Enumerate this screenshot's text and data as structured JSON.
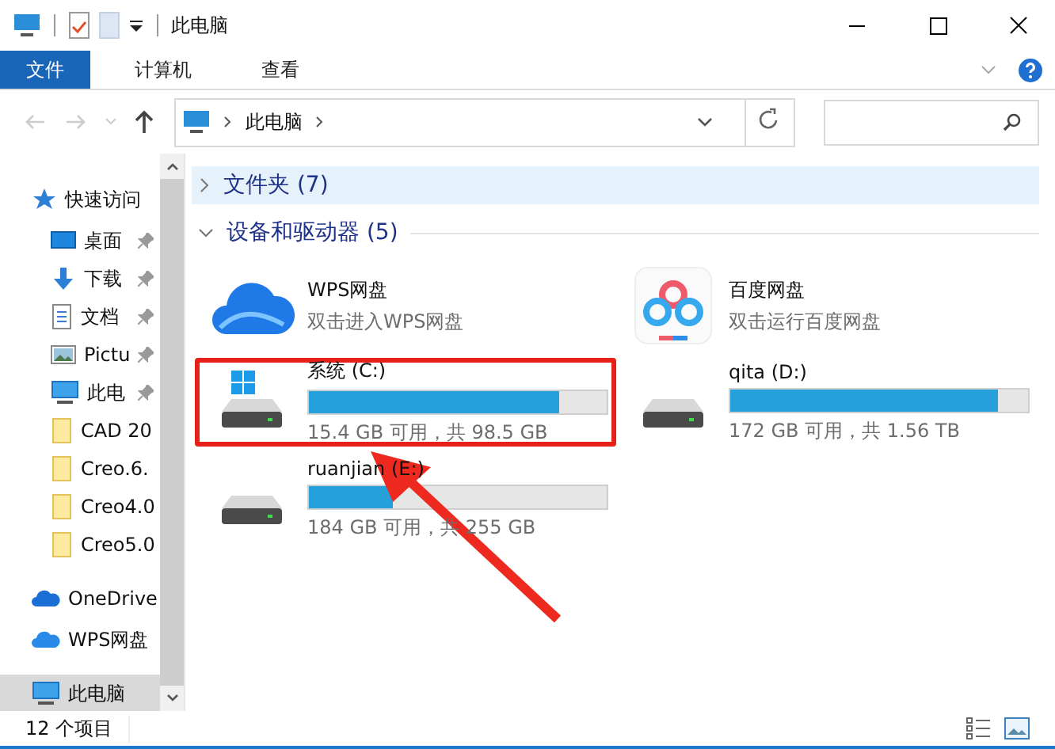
{
  "window": {
    "title": "此电脑"
  },
  "ribbon_tabs": [
    {
      "label": "文件",
      "selected": true
    },
    {
      "label": "计算机",
      "selected": false
    },
    {
      "label": "查看",
      "selected": false
    }
  ],
  "address": {
    "crumbs": [
      "此电脑"
    ]
  },
  "sidebar": {
    "items": [
      {
        "label": "快速访问",
        "kind": "star",
        "pinned": false,
        "selected": false,
        "group": true
      },
      {
        "label": "桌面",
        "kind": "desktop",
        "pinned": true,
        "selected": false,
        "group": false
      },
      {
        "label": "下载",
        "kind": "download",
        "pinned": true,
        "selected": false,
        "group": false
      },
      {
        "label": "文档",
        "kind": "document",
        "pinned": true,
        "selected": false,
        "group": false
      },
      {
        "label": "Pictu",
        "kind": "picture",
        "pinned": true,
        "selected": false,
        "group": false
      },
      {
        "label": "此电",
        "kind": "computer",
        "pinned": true,
        "selected": false,
        "group": false
      },
      {
        "label": "CAD 20",
        "kind": "folder",
        "pinned": false,
        "selected": false,
        "group": false
      },
      {
        "label": "Creo.6.",
        "kind": "folder",
        "pinned": false,
        "selected": false,
        "group": false
      },
      {
        "label": "Creo4.0",
        "kind": "folder",
        "pinned": false,
        "selected": false,
        "group": false
      },
      {
        "label": "Creo5.0",
        "kind": "folder",
        "pinned": false,
        "selected": false,
        "group": false
      },
      {
        "label": "OneDrive",
        "kind": "onedrive",
        "pinned": false,
        "selected": false,
        "group": true
      },
      {
        "label": "WPS网盘",
        "kind": "wps",
        "pinned": false,
        "selected": false,
        "group": true
      },
      {
        "label": "此电脑",
        "kind": "computer",
        "pinned": false,
        "selected": true,
        "group": true
      }
    ]
  },
  "sections": [
    {
      "title": "文件夹 (7)",
      "expanded": false
    },
    {
      "title": "设备和驱动器 (5)",
      "expanded": true
    }
  ],
  "devices": [
    {
      "kind": "wps",
      "name": "WPS网盘",
      "detail": "双击进入WPS网盘",
      "highlighted": false
    },
    {
      "kind": "baidu",
      "name": "百度网盘",
      "detail": "双击运行百度网盘",
      "highlighted": false
    },
    {
      "kind": "drive",
      "system": true,
      "name": "系统 (C:)",
      "level": 0.84,
      "detail": "15.4 GB 可用，共 98.5 GB",
      "highlighted": true
    },
    {
      "kind": "drive",
      "system": false,
      "name": "qita (D:)",
      "level": 0.9,
      "detail": "172 GB 可用，共 1.56 TB",
      "highlighted": false
    },
    {
      "kind": "drive",
      "system": false,
      "name": "ruanjian (E:)",
      "level": 0.28,
      "detail": "184 GB 可用，共 255 GB",
      "highlighted": false
    }
  ],
  "status_bar": {
    "count": "12 个项目"
  }
}
